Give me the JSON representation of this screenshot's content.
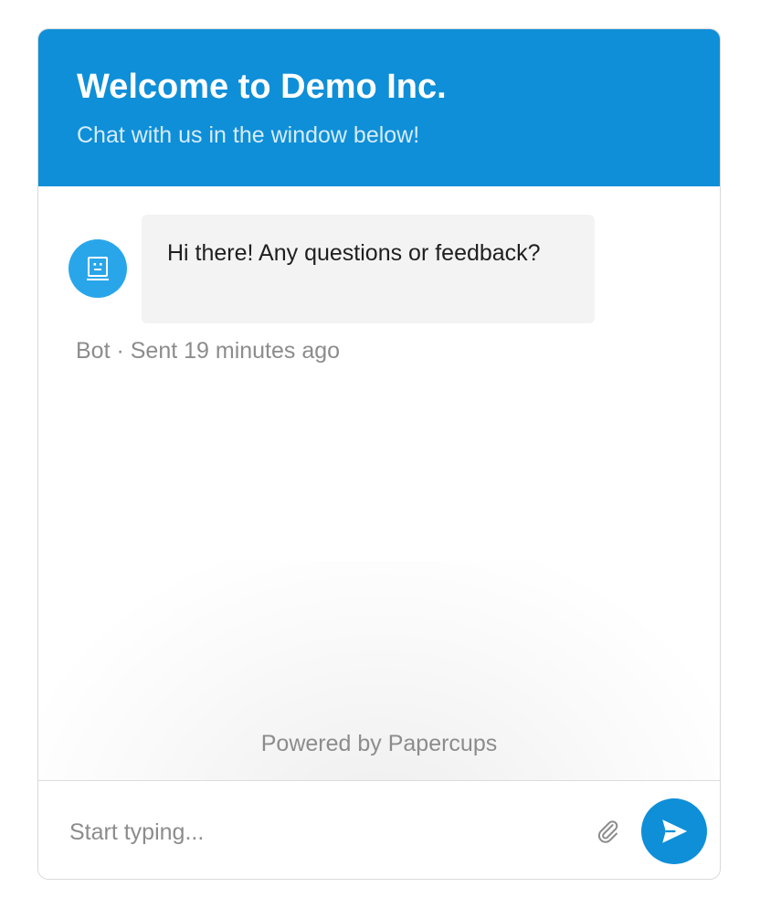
{
  "header": {
    "title": "Welcome to Demo Inc.",
    "subtitle": "Chat with us in the window below!"
  },
  "messages": [
    {
      "sender": "Bot",
      "avatar_icon": "robot-icon",
      "text": "Hi there! Any questions or feedback?",
      "meta": "Bot · Sent 19 minutes ago"
    }
  ],
  "footer": {
    "powered_by": "Powered by Papercups"
  },
  "composer": {
    "value": "",
    "placeholder": "Start typing...",
    "attach_icon": "paperclip-icon",
    "send_icon": "send-icon"
  },
  "colors": {
    "brand": "#0e8fd8",
    "avatar": "#29a6ea",
    "bubble": "#f3f3f3",
    "muted_text": "#8c8c8c"
  }
}
